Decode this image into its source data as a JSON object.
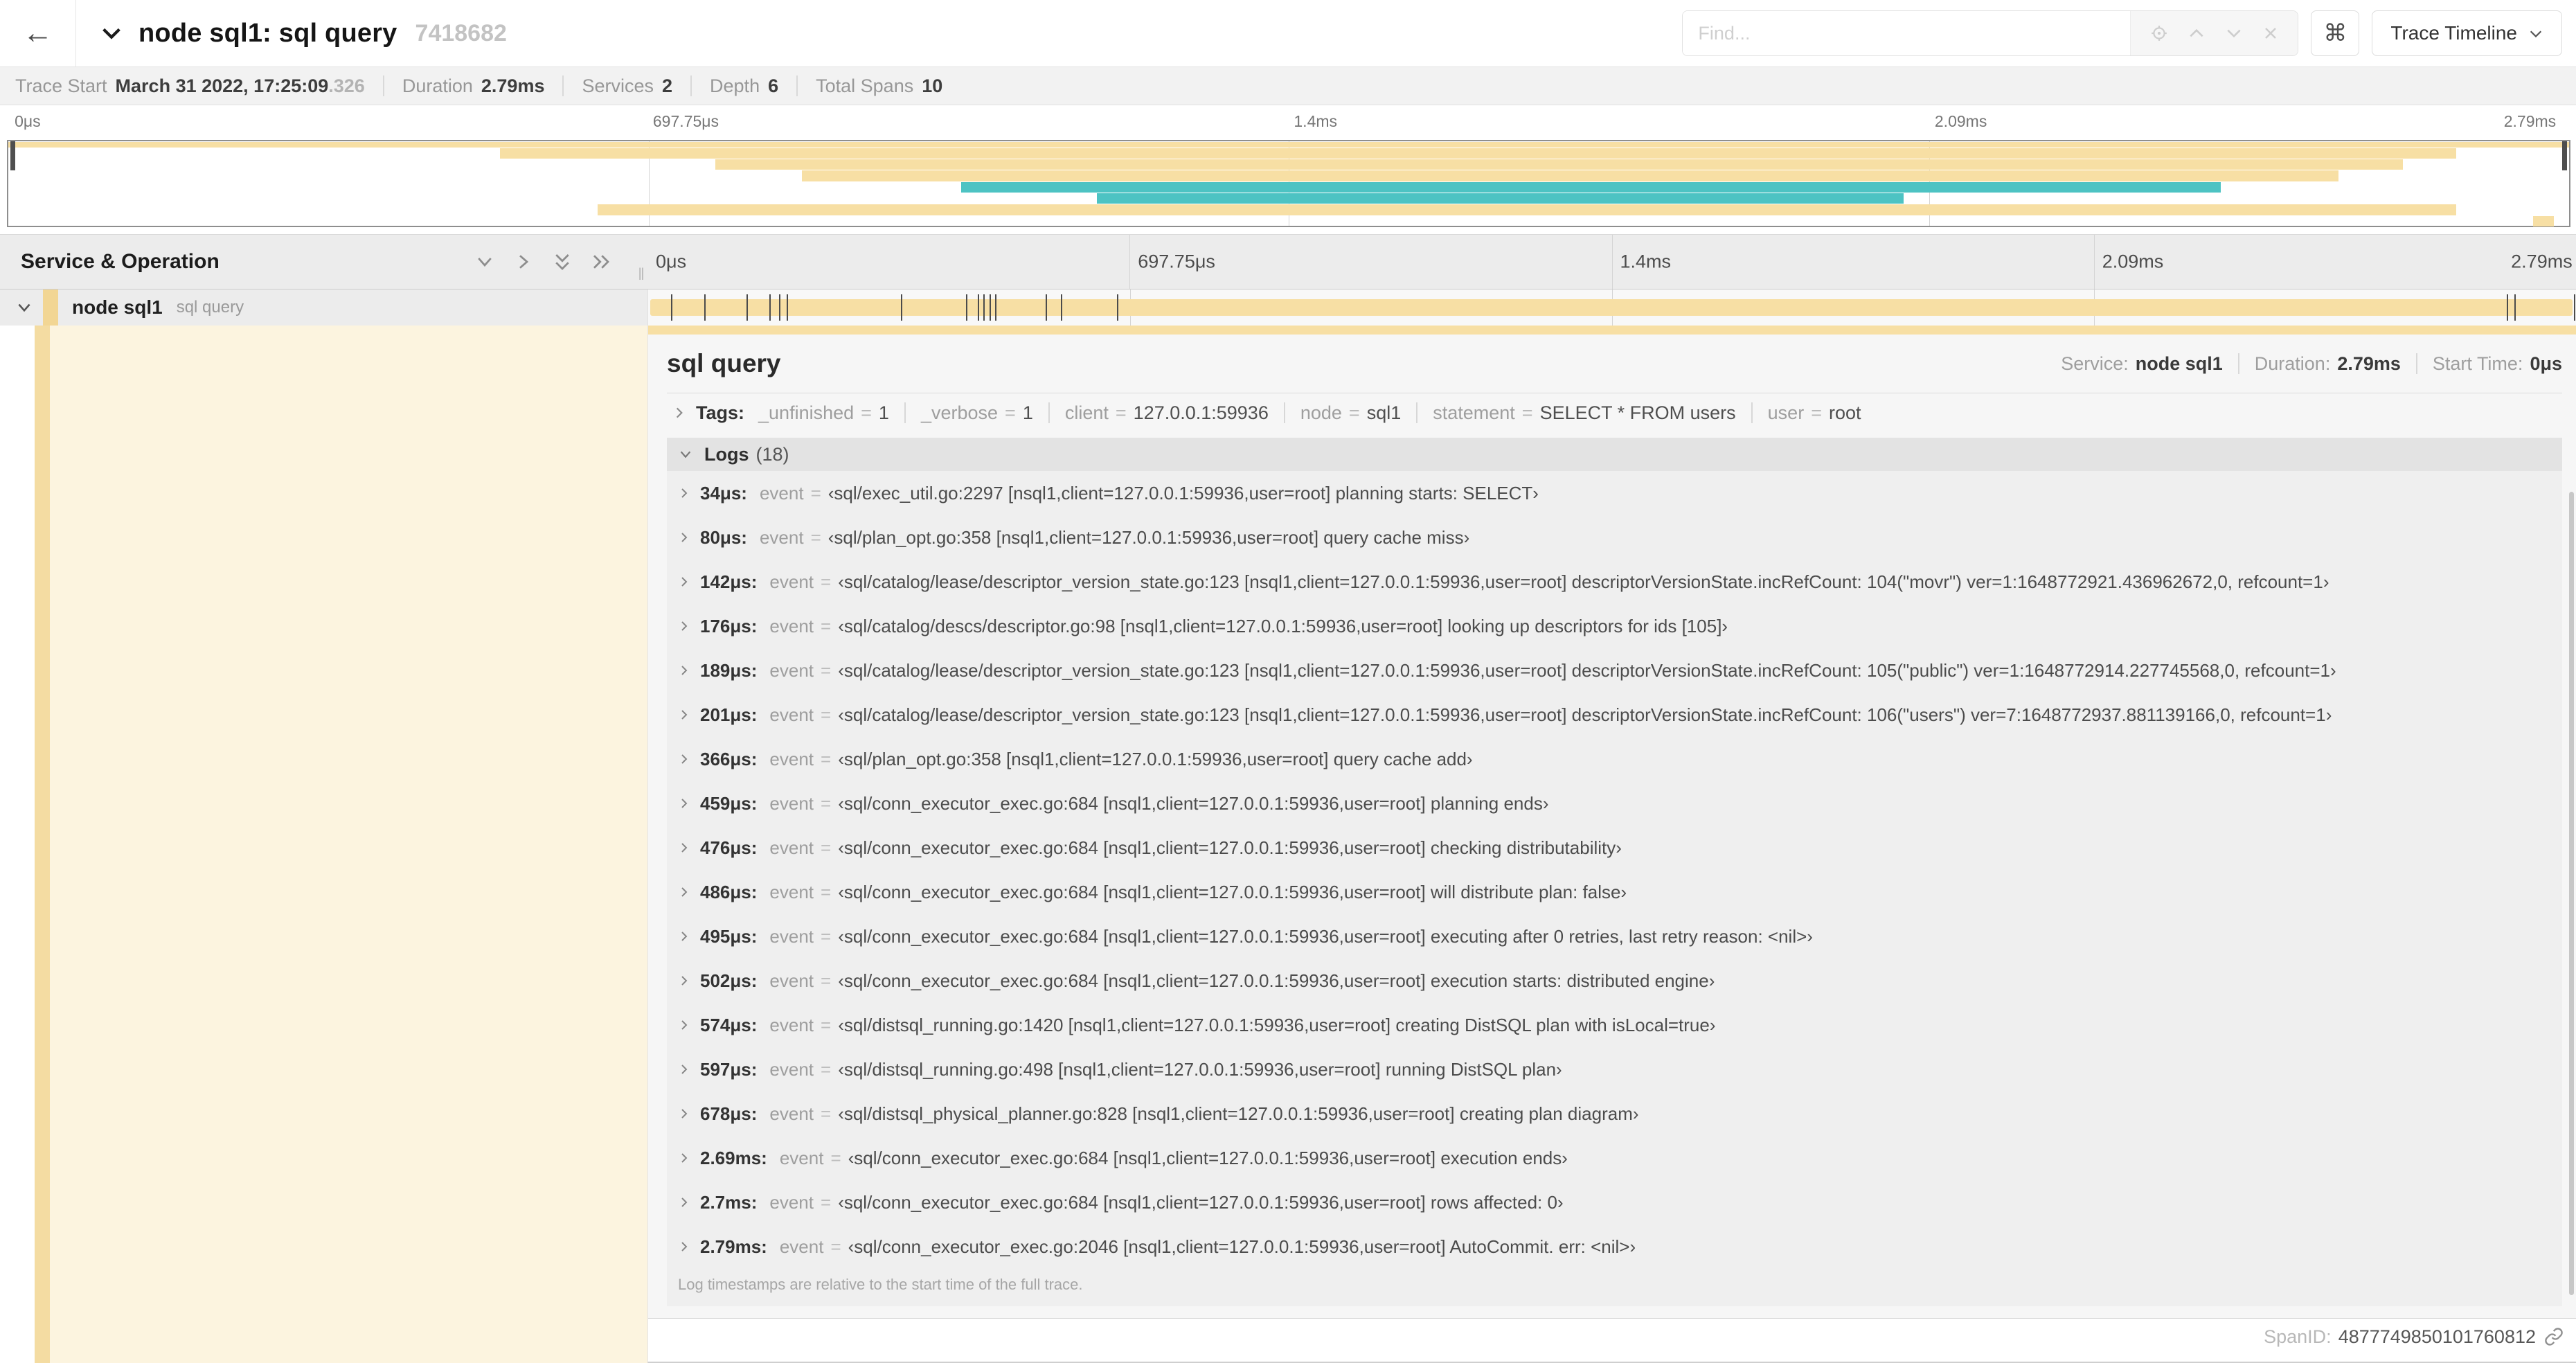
{
  "symbols": {
    "eq": "="
  },
  "header": {
    "back_icon": "←",
    "title": "node sql1: sql query",
    "trace_id": "7418682",
    "find_placeholder": "Find...",
    "shortcut_icon": "⌘",
    "view_selector_label": "Trace Timeline"
  },
  "summary": {
    "items": [
      {
        "label": "Trace Start",
        "value": "March 31 2022, 17:25:09",
        "suffix": ".326"
      },
      {
        "label": "Duration",
        "value": "2.79ms",
        "suffix": ""
      },
      {
        "label": "Services",
        "value": "2",
        "suffix": ""
      },
      {
        "label": "Depth",
        "value": "6",
        "suffix": ""
      },
      {
        "label": "Total Spans",
        "value": "10",
        "suffix": ""
      }
    ]
  },
  "colors": {
    "span_tan": "#F7DFA4",
    "span_teal": "#4DC3C3",
    "detail_cream": "#FCF4DF"
  },
  "minimap": {
    "labels": [
      {
        "label": "0μs",
        "left": "0.3%"
      },
      {
        "label": "697.75μs",
        "left": "25.2%"
      },
      {
        "label": "1.4ms",
        "left": "50.2%"
      },
      {
        "label": "2.09ms",
        "left": "75.2%"
      },
      {
        "label": "2.79ms",
        "left": "97.4%"
      }
    ],
    "bars": [
      {
        "left": "0%",
        "width": "100%",
        "color": "#F7DFA4"
      },
      {
        "left": "19.2%",
        "width": "76.4%",
        "color": "#F7DFA4"
      },
      {
        "left": "27.6%",
        "width": "65.9%",
        "color": "#F7DFA4"
      },
      {
        "left": "31%",
        "width": "60%",
        "color": "#F7DFA4"
      },
      {
        "left": "37.2%",
        "width": "49.2%",
        "color": "#4DC3C3"
      },
      {
        "left": "42.5%",
        "width": "31.5%",
        "color": "#4DC3C3"
      },
      {
        "left": "23%",
        "width": "72.6%",
        "color": "#F7DFA4"
      },
      {
        "left": "98.6%",
        "width": "0.8%",
        "color": "#F7DFA4"
      }
    ]
  },
  "timeline": {
    "panel_title": "Service & Operation",
    "ruler_labels": [
      {
        "label": "0μs",
        "left": "0%"
      },
      {
        "label": "697.75μs",
        "left": "25%"
      },
      {
        "label": "1.4ms",
        "left": "50%"
      },
      {
        "label": "2.09ms",
        "left": "75%"
      },
      {
        "label": "2.79ms",
        "left": "96.2%"
      }
    ],
    "row": {
      "service": "node sql1",
      "operation": "sql query"
    },
    "log_markers": [
      {
        "left": "1.2%"
      },
      {
        "left": "2.9%"
      },
      {
        "left": "5.1%"
      },
      {
        "left": "6.3%"
      },
      {
        "left": "6.8%"
      },
      {
        "left": "7.2%"
      },
      {
        "left": "13.1%"
      },
      {
        "left": "16.5%"
      },
      {
        "left": "17.1%"
      },
      {
        "left": "17.4%"
      },
      {
        "left": "17.7%"
      },
      {
        "left": "18%"
      },
      {
        "left": "20.6%"
      },
      {
        "left": "21.4%"
      },
      {
        "left": "24.3%"
      },
      {
        "left": "96.4%"
      },
      {
        "left": "96.8%"
      },
      {
        "left": "99.9%"
      }
    ]
  },
  "span_detail": {
    "title": "sql query",
    "service_label": "Service:",
    "service_value": "node sql1",
    "duration_label": "Duration:",
    "duration_value": "2.79ms",
    "start_label": "Start Time:",
    "start_value": "0μs",
    "tags_label": "Tags:",
    "tags": [
      {
        "key": "_unfinished",
        "value": "1"
      },
      {
        "key": "_verbose",
        "value": "1"
      },
      {
        "key": "client",
        "value": "127.0.0.1:59936"
      },
      {
        "key": "node",
        "value": "sql1"
      },
      {
        "key": "statement",
        "value": "SELECT * FROM users"
      },
      {
        "key": "user",
        "value": "root"
      }
    ],
    "logs_label": "Logs",
    "logs_count": "(18)",
    "logs": [
      {
        "time": "34μs:",
        "key": "event",
        "value": "‹sql/exec_util.go:2297 [nsql1,client=127.0.0.1:59936,user=root] planning starts: SELECT›"
      },
      {
        "time": "80μs:",
        "key": "event",
        "value": "‹sql/plan_opt.go:358 [nsql1,client=127.0.0.1:59936,user=root] query cache miss›"
      },
      {
        "time": "142μs:",
        "key": "event",
        "value": "‹sql/catalog/lease/descriptor_version_state.go:123 [nsql1,client=127.0.0.1:59936,user=root] descriptorVersionState.incRefCount: 104(\"movr\") ver=1:1648772921.436962672,0, refcount=1›"
      },
      {
        "time": "176μs:",
        "key": "event",
        "value": "‹sql/catalog/descs/descriptor.go:98 [nsql1,client=127.0.0.1:59936,user=root] looking up descriptors for ids [105]›"
      },
      {
        "time": "189μs:",
        "key": "event",
        "value": "‹sql/catalog/lease/descriptor_version_state.go:123 [nsql1,client=127.0.0.1:59936,user=root] descriptorVersionState.incRefCount: 105(\"public\") ver=1:1648772914.227745568,0, refcount=1›"
      },
      {
        "time": "201μs:",
        "key": "event",
        "value": "‹sql/catalog/lease/descriptor_version_state.go:123 [nsql1,client=127.0.0.1:59936,user=root] descriptorVersionState.incRefCount: 106(\"users\") ver=7:1648772937.881139166,0, refcount=1›"
      },
      {
        "time": "366μs:",
        "key": "event",
        "value": "‹sql/plan_opt.go:358 [nsql1,client=127.0.0.1:59936,user=root] query cache add›"
      },
      {
        "time": "459μs:",
        "key": "event",
        "value": "‹sql/conn_executor_exec.go:684 [nsql1,client=127.0.0.1:59936,user=root] planning ends›"
      },
      {
        "time": "476μs:",
        "key": "event",
        "value": "‹sql/conn_executor_exec.go:684 [nsql1,client=127.0.0.1:59936,user=root] checking distributability›"
      },
      {
        "time": "486μs:",
        "key": "event",
        "value": "‹sql/conn_executor_exec.go:684 [nsql1,client=127.0.0.1:59936,user=root] will distribute plan: false›"
      },
      {
        "time": "495μs:",
        "key": "event",
        "value": "‹sql/conn_executor_exec.go:684 [nsql1,client=127.0.0.1:59936,user=root] executing after 0 retries, last retry reason: <nil>›"
      },
      {
        "time": "502μs:",
        "key": "event",
        "value": "‹sql/conn_executor_exec.go:684 [nsql1,client=127.0.0.1:59936,user=root] execution starts: distributed engine›"
      },
      {
        "time": "574μs:",
        "key": "event",
        "value": "‹sql/distsql_running.go:1420 [nsql1,client=127.0.0.1:59936,user=root] creating DistSQL plan with isLocal=true›"
      },
      {
        "time": "597μs:",
        "key": "event",
        "value": "‹sql/distsql_running.go:498 [nsql1,client=127.0.0.1:59936,user=root] running DistSQL plan›"
      },
      {
        "time": "678μs:",
        "key": "event",
        "value": "‹sql/distsql_physical_planner.go:828 [nsql1,client=127.0.0.1:59936,user=root] creating plan diagram›"
      },
      {
        "time": "2.69ms:",
        "key": "event",
        "value": "‹sql/conn_executor_exec.go:684 [nsql1,client=127.0.0.1:59936,user=root] execution ends›"
      },
      {
        "time": "2.7ms:",
        "key": "event",
        "value": "‹sql/conn_executor_exec.go:684 [nsql1,client=127.0.0.1:59936,user=root] rows affected: 0›"
      },
      {
        "time": "2.79ms:",
        "key": "event",
        "value": "‹sql/conn_executor_exec.go:2046 [nsql1,client=127.0.0.1:59936,user=root] AutoCommit. err: <nil>›"
      }
    ],
    "logs_footer": "Log timestamps are relative to the start time of the full trace.",
    "spanid_label": "SpanID:",
    "spanid_value": "4877749850101760812"
  }
}
